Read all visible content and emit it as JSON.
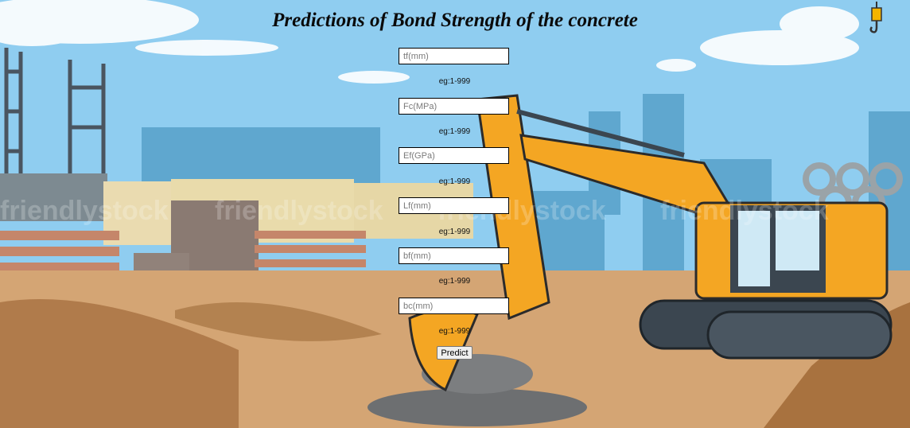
{
  "page": {
    "title": "Predictions of Bond Strength of the concrete"
  },
  "form": {
    "fields": [
      {
        "placeholder": "tf(mm)",
        "value": "",
        "hint": "eg:1-999"
      },
      {
        "placeholder": "Fc(MPa)",
        "value": "",
        "hint": "eg:1-999"
      },
      {
        "placeholder": "Ef(GPa)",
        "value": "",
        "hint": "eg:1-999"
      },
      {
        "placeholder": "Lf(mm)",
        "value": "",
        "hint": "eg:1-999"
      },
      {
        "placeholder": "bf(mm)",
        "value": "",
        "hint": "eg:1-999"
      },
      {
        "placeholder": "bc(mm)",
        "value": "",
        "hint": "eg:1-999"
      }
    ],
    "submit_label": "Predict"
  },
  "background": {
    "scene": "construction-site-with-excavator",
    "watermark": "friendlystock",
    "colors": {
      "sky": "#8ccbee",
      "ground": "#c9955f",
      "excavator": "#f6a623",
      "track": "#3b4650"
    }
  }
}
